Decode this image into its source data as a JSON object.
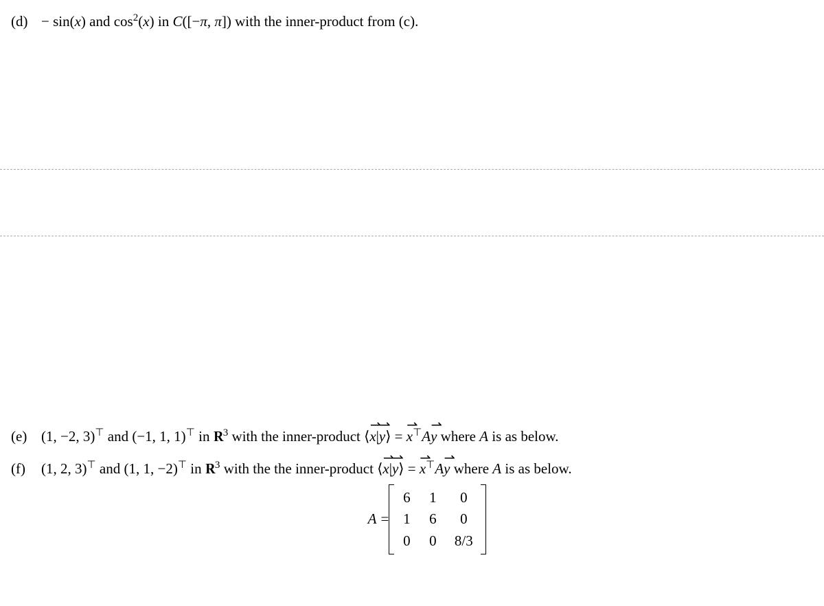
{
  "problems": {
    "d": {
      "label": "(d)",
      "text_parts": {
        "p1": "− sin(",
        "var1": "x",
        "p2": ") and cos",
        "exp1": "2",
        "p3": "(",
        "var2": "x",
        "p4": ") in ",
        "var3": "C",
        "p5": "([−",
        "pi1": "π",
        "p6": ", ",
        "pi2": "π",
        "p7": "]) with the inner-product from (c)."
      }
    },
    "e": {
      "label": "(e)",
      "text_parts": {
        "v1": "(1, −2, 3)",
        "t1": "⊤",
        "p1": " and ",
        "v2": "(−1, 1, 1)",
        "t2": "⊤",
        "p2": " in ",
        "rr": "R",
        "exp3": "3",
        "p3": " with the inner-product ⟨",
        "vec_x1": "x",
        "bar": "|",
        "vec_y1": "y",
        "p4": "⟩ = ",
        "vec_x2": "x",
        "t3": "⊤",
        "A1": "A",
        "vec_y2": "y",
        "p5": " where ",
        "A2": "A",
        "p6": " is as below."
      }
    },
    "f": {
      "label": "(f)",
      "text_parts": {
        "v1": "(1, 2, 3)",
        "t1": "⊤",
        "p1": " and ",
        "v2": "(1, 1, −2)",
        "t2": "⊤",
        "p2": " in ",
        "rr": "R",
        "exp3": "3",
        "p3": " with the the inner-product ⟨",
        "vec_x1": "x",
        "bar": "|",
        "vec_y1": "y",
        "p4": "⟩ = ",
        "vec_x2": "x",
        "t3": "⊤",
        "A1": "A",
        "vec_y2": "y",
        "p5": " where ",
        "A2": "A",
        "p6": " is as below."
      }
    }
  },
  "matrix": {
    "label": "A",
    "equals": " = ",
    "rows": [
      [
        "6",
        "1",
        "0"
      ],
      [
        "1",
        "6",
        "0"
      ],
      [
        "0",
        "0",
        "8/3"
      ]
    ]
  }
}
